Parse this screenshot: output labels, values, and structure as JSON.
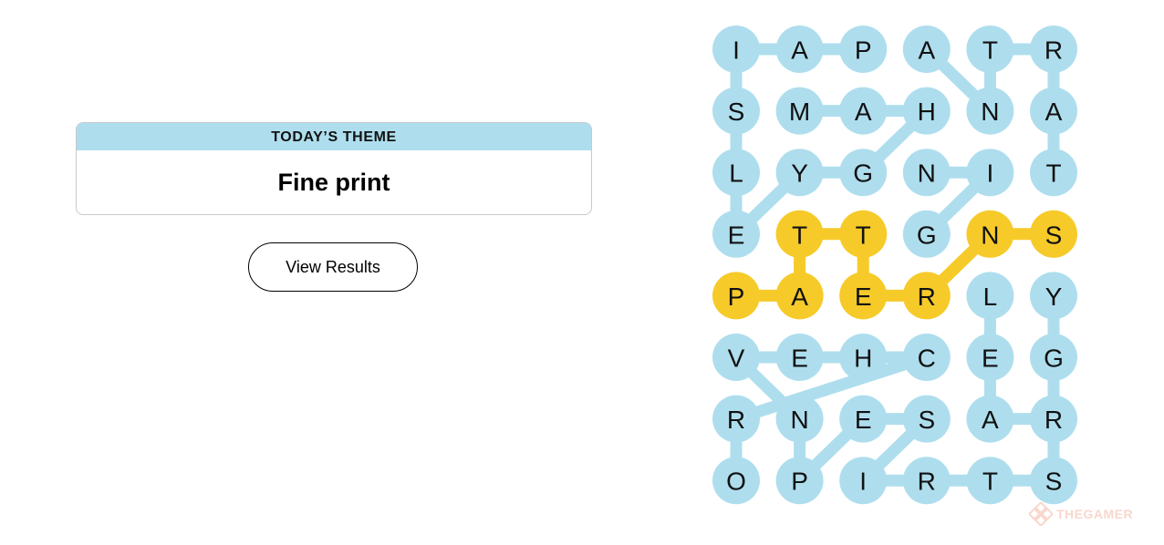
{
  "theme": {
    "header": "TODAY’S THEME",
    "value": "Fine print"
  },
  "actions": {
    "view_results_label": "View Results"
  },
  "colors": {
    "found": "#aedeee",
    "spangram": "#f6ca29",
    "theme_header_bg": "#aedeee",
    "text": "#111111"
  },
  "grid": {
    "rows": [
      [
        "I",
        "A",
        "P",
        "A",
        "T",
        "R"
      ],
      [
        "S",
        "M",
        "A",
        "H",
        "N",
        "A"
      ],
      [
        "L",
        "Y",
        "G",
        "N",
        "I",
        "T"
      ],
      [
        "E",
        "T",
        "T",
        "G",
        "N",
        "S"
      ],
      [
        "P",
        "A",
        "E",
        "R",
        "L",
        "Y"
      ],
      [
        "V",
        "E",
        "H",
        "C",
        "E",
        "G"
      ],
      [
        "R",
        "N",
        "E",
        "S",
        "A",
        "R"
      ],
      [
        "O",
        "P",
        "I",
        "R",
        "T",
        "S"
      ]
    ],
    "found_words": [
      {
        "type": "theme",
        "path": [
          [
            3,
            0
          ],
          [
            2,
            0
          ],
          [
            1,
            0
          ],
          [
            0,
            0
          ],
          [
            0,
            1
          ],
          [
            0,
            2
          ]
        ]
      },
      {
        "type": "theme",
        "path": [
          [
            1,
            1
          ],
          [
            1,
            2
          ],
          [
            1,
            3
          ],
          [
            2,
            2
          ],
          [
            2,
            1
          ],
          [
            3,
            0
          ]
        ]
      },
      {
        "type": "theme",
        "path": [
          [
            0,
            3
          ],
          [
            1,
            4
          ],
          [
            0,
            4
          ],
          [
            0,
            5
          ],
          [
            1,
            5
          ],
          [
            2,
            5
          ]
        ]
      },
      {
        "type": "theme",
        "path": [
          [
            2,
            3
          ],
          [
            2,
            4
          ],
          [
            3,
            3
          ]
        ]
      },
      {
        "type": "spangram",
        "path": [
          [
            4,
            0
          ],
          [
            4,
            1
          ],
          [
            3,
            1
          ],
          [
            3,
            2
          ],
          [
            4,
            2
          ],
          [
            4,
            3
          ],
          [
            3,
            4
          ],
          [
            3,
            5
          ]
        ]
      },
      {
        "type": "theme",
        "path": [
          [
            4,
            4
          ],
          [
            5,
            4
          ],
          [
            6,
            4
          ],
          [
            6,
            5
          ],
          [
            5,
            5
          ],
          [
            4,
            5
          ],
          [
            7,
            5
          ],
          [
            7,
            4
          ],
          [
            7,
            3
          ],
          [
            7,
            2
          ],
          [
            6,
            3
          ],
          [
            6,
            2
          ],
          [
            7,
            1
          ],
          [
            6,
            1
          ],
          [
            5,
            0
          ],
          [
            5,
            1
          ],
          [
            5,
            2
          ],
          [
            5,
            3
          ],
          [
            6,
            0
          ],
          [
            7,
            0
          ]
        ]
      }
    ]
  },
  "watermark": {
    "text": "THEGAMER"
  }
}
